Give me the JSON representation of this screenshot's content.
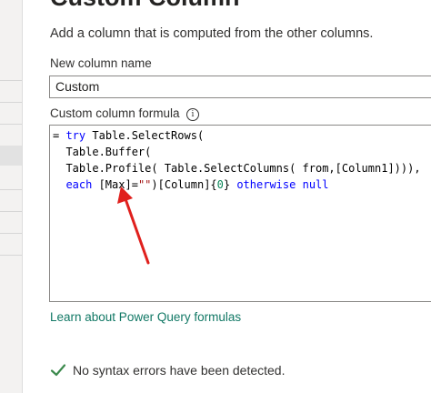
{
  "dialog": {
    "title": "Custom Column",
    "subtitle": "Add a column that is computed from the other columns."
  },
  "new_column": {
    "label": "New column name",
    "value": "Custom"
  },
  "formula": {
    "label": "Custom column formula",
    "info_icon": "info-icon",
    "lines": [
      {
        "parts": [
          {
            "t": "= ",
            "c": "plain"
          },
          {
            "t": "try",
            "c": "kw"
          },
          {
            "t": " Table.SelectRows(",
            "c": "plain"
          }
        ]
      },
      {
        "parts": [
          {
            "t": "  Table.Buffer(",
            "c": "plain"
          }
        ]
      },
      {
        "parts": [
          {
            "t": "  Table.Profile( Table.SelectColumns( from,[Column1]))),",
            "c": "plain"
          }
        ]
      },
      {
        "parts": [
          {
            "t": "  each",
            "c": "kw"
          },
          {
            "t": " [Max]=",
            "c": "plain"
          },
          {
            "t": "\"\"",
            "c": "str"
          },
          {
            "t": ")[Column]{",
            "c": "plain"
          },
          {
            "t": "0",
            "c": "num"
          },
          {
            "t": "} ",
            "c": "plain"
          },
          {
            "t": "otherwise",
            "c": "kw"
          },
          {
            "t": " ",
            "c": "plain"
          },
          {
            "t": "null",
            "c": "kw2"
          }
        ]
      }
    ]
  },
  "learn_link": "Learn about Power Query formulas",
  "status": {
    "icon": "checkmark-icon",
    "text": "No syntax errors have been detected."
  },
  "colors": {
    "keyword": "#0000ff",
    "string": "#a31515",
    "number": "#098658",
    "link": "#117865",
    "check": "#3c8a4d",
    "annotation_arrow": "#e0201d"
  }
}
